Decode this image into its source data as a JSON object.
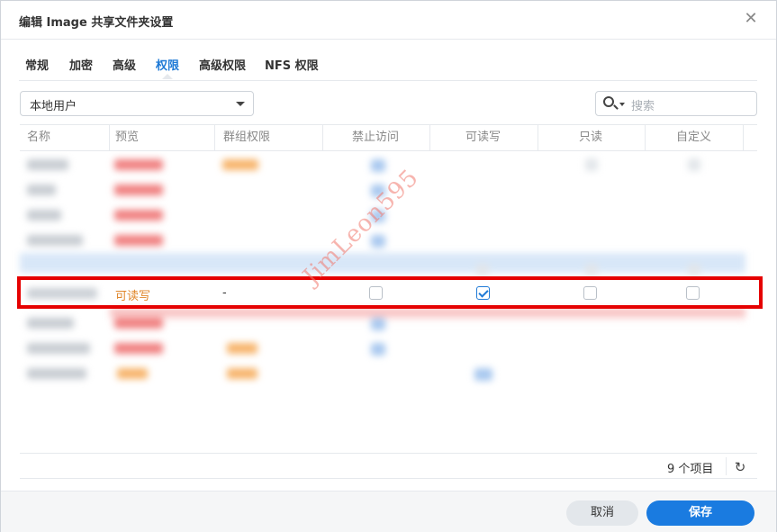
{
  "dialog": {
    "title": "编辑 Image 共享文件夹设置",
    "close_icon": "close-icon"
  },
  "tabs": [
    {
      "label": "常规"
    },
    {
      "label": "加密"
    },
    {
      "label": "高级"
    },
    {
      "label": "权限",
      "active": true
    },
    {
      "label": "高级权限"
    },
    {
      "label": "NFS 权限"
    }
  ],
  "filter": {
    "user_type": "本地用户",
    "search_placeholder": "搜索"
  },
  "table": {
    "columns": [
      "名称",
      "预览",
      "群组权限",
      "禁止访问",
      "可读写",
      "只读",
      "自定义"
    ],
    "highlighted_row": {
      "preview": "可读写",
      "group_permission": "-",
      "deny_access": false,
      "read_write": true,
      "read_only": false,
      "custom": false
    }
  },
  "watermark": "JimLeon595",
  "footer": {
    "item_count": "9 个项目",
    "refresh_icon": "refresh-icon"
  },
  "buttons": {
    "cancel": "取消",
    "save": "保存"
  },
  "colors": {
    "accent": "#1a7be0",
    "highlight_border": "#e50000",
    "permission_text": "#e0862a"
  }
}
